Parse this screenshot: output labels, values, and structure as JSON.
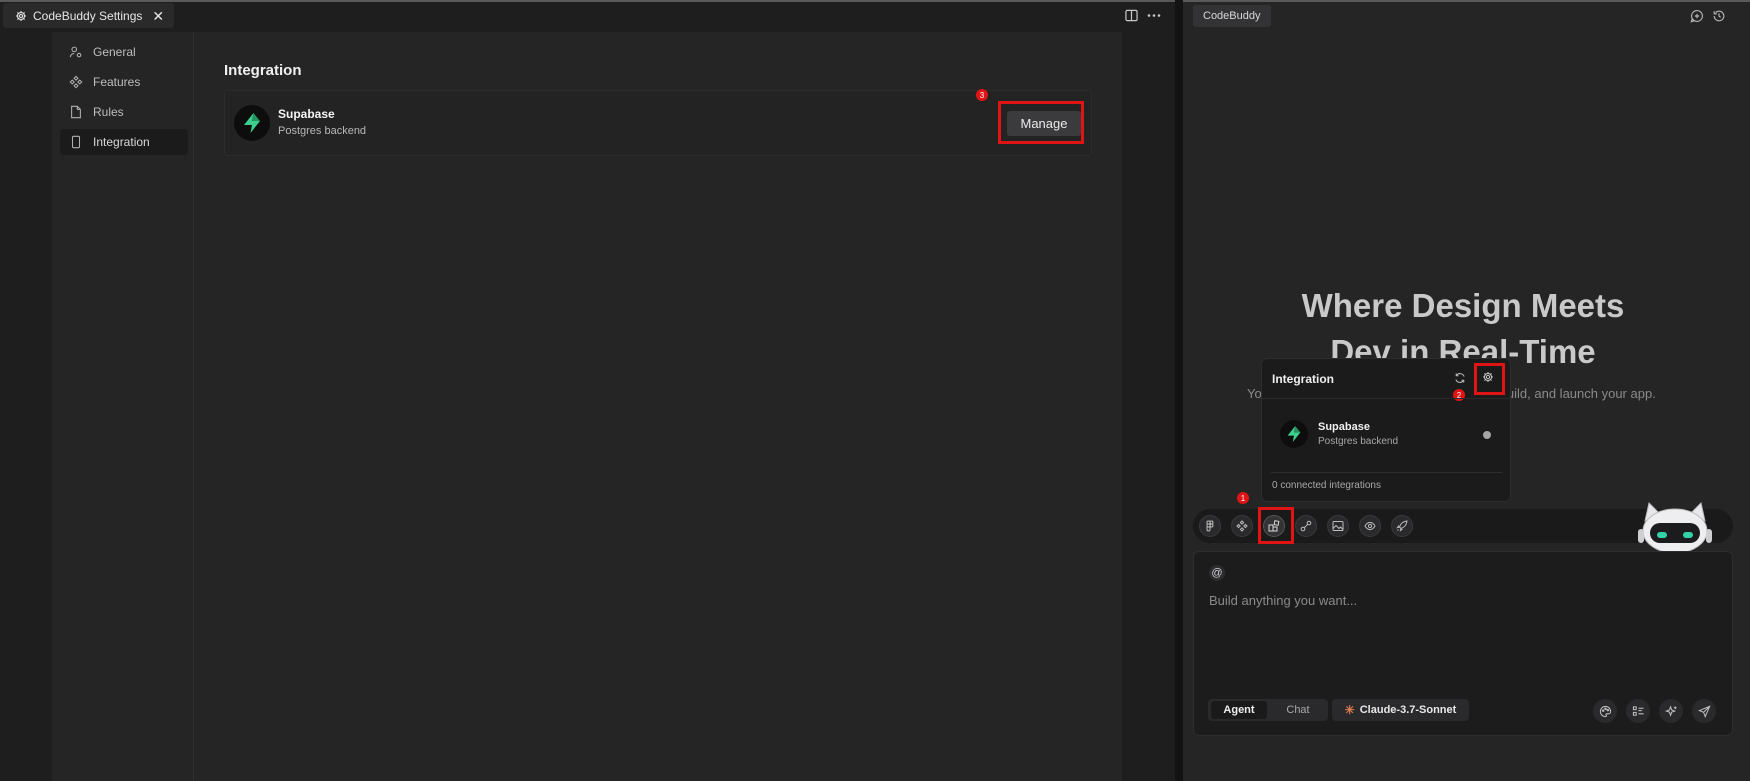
{
  "left": {
    "tab": {
      "title": "CodeBuddy Settings",
      "close": "✕"
    },
    "nav": [
      {
        "id": "general",
        "label": "General",
        "icon": "person-gear-icon"
      },
      {
        "id": "features",
        "label": "Features",
        "icon": "components-icon"
      },
      {
        "id": "rules",
        "label": "Rules",
        "icon": "file-icon"
      },
      {
        "id": "integration",
        "label": "Integration",
        "icon": "phone-icon",
        "active": true
      }
    ],
    "main": {
      "title": "Integration",
      "card": {
        "name": "Supabase",
        "description": "Postgres backend",
        "button": "Manage"
      }
    }
  },
  "right": {
    "tab": "CodeBuddy",
    "hero": {
      "title_line1": "Where Design Meets",
      "title_line2": "Dev in Real-Time",
      "subtitle_left": "Yo",
      "subtitle_right": "an, build, and launch your app."
    },
    "popup": {
      "title": "Integration",
      "item": {
        "name": "Supabase",
        "description": "Postgres backend"
      },
      "footer": "0 connected integrations"
    },
    "input": {
      "at": "@",
      "placeholder": "Build anything you want..."
    },
    "modes": {
      "agent": "Agent",
      "chat": "Chat"
    },
    "model": "Claude-3.7-Sonnet"
  },
  "annotations": {
    "badge1": "1",
    "badge2": "2",
    "badge3": "3"
  },
  "colors": {
    "highlight": "#e01414",
    "supabase": "#3ecf8e",
    "model_star": "#e07a4f"
  }
}
